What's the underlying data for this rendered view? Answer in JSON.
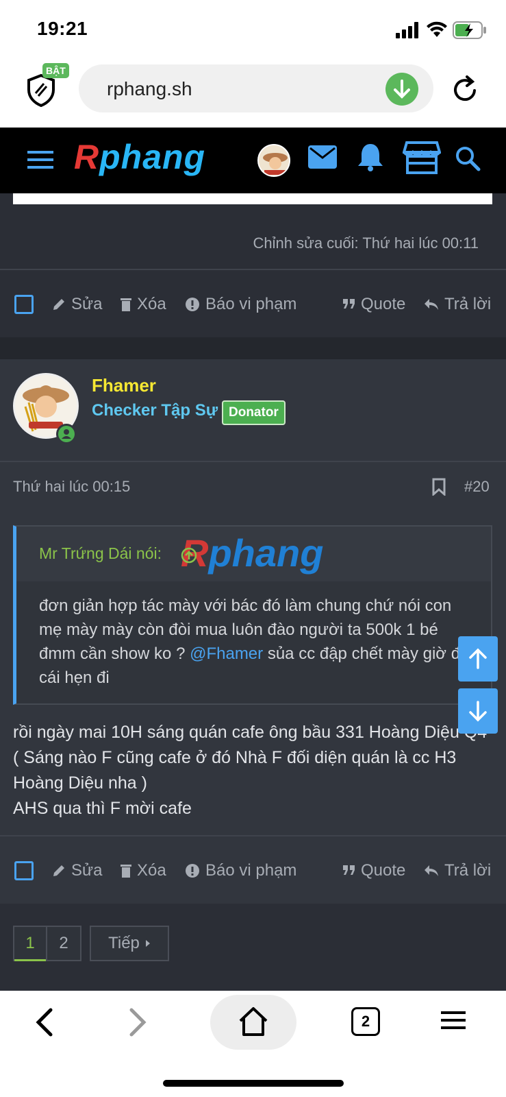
{
  "status_bar": {
    "time": "19:21"
  },
  "browser": {
    "shield_badge": "BẬT",
    "url": "rphang.sh"
  },
  "site": {
    "logo_first": "R",
    "logo_rest": "phang"
  },
  "prev_post": {
    "edited": "Chỉnh sửa cuối: Thứ hai lúc 00:11",
    "actions": {
      "edit": "Sửa",
      "delete": "Xóa",
      "report": "Báo vi phạm",
      "quote": "Quote",
      "reply": "Trả lời"
    }
  },
  "post": {
    "username": "Fhamer",
    "user_title": "Checker Tập Sự",
    "badge": "Donator",
    "date": "Thứ hai lúc 00:15",
    "number": "#20",
    "quote": {
      "author": "Mr Trứng Dái nói:",
      "logo_text": "Rphang",
      "text_before": "đơn giản hợp tác mày với bác đó làm chung chứ nói con mẹ mày mày còn đòi mua luôn đào người ta 500k 1 bé đmm cần show ko ? ",
      "mention": "@Fhamer",
      "text_after": " sủa cc đập chết mày giờ đá cái hẹn đi"
    },
    "body_line1": "rồi ngày mai 10H sáng quán cafe ông bầu 331 Hoàng Diệu Q4 ( Sáng nào F cũng cafe ở đó Nhà F đối diện quán là cc H3 Hoàng Diệu nha )",
    "body_line2": "AHS qua thì F mời cafe",
    "actions": {
      "edit": "Sửa",
      "delete": "Xóa",
      "report": "Báo vi phạm",
      "quote": "Quote",
      "reply": "Trả lời"
    }
  },
  "pagination": {
    "page1": "1",
    "page2": "2",
    "next": "Tiếp"
  },
  "bottom_bar": {
    "tab_count": "2"
  },
  "colors": {
    "accent_blue": "#4aa3f0",
    "green": "#4caf50",
    "username": "#f6e833",
    "bg": "#2b2e36"
  }
}
